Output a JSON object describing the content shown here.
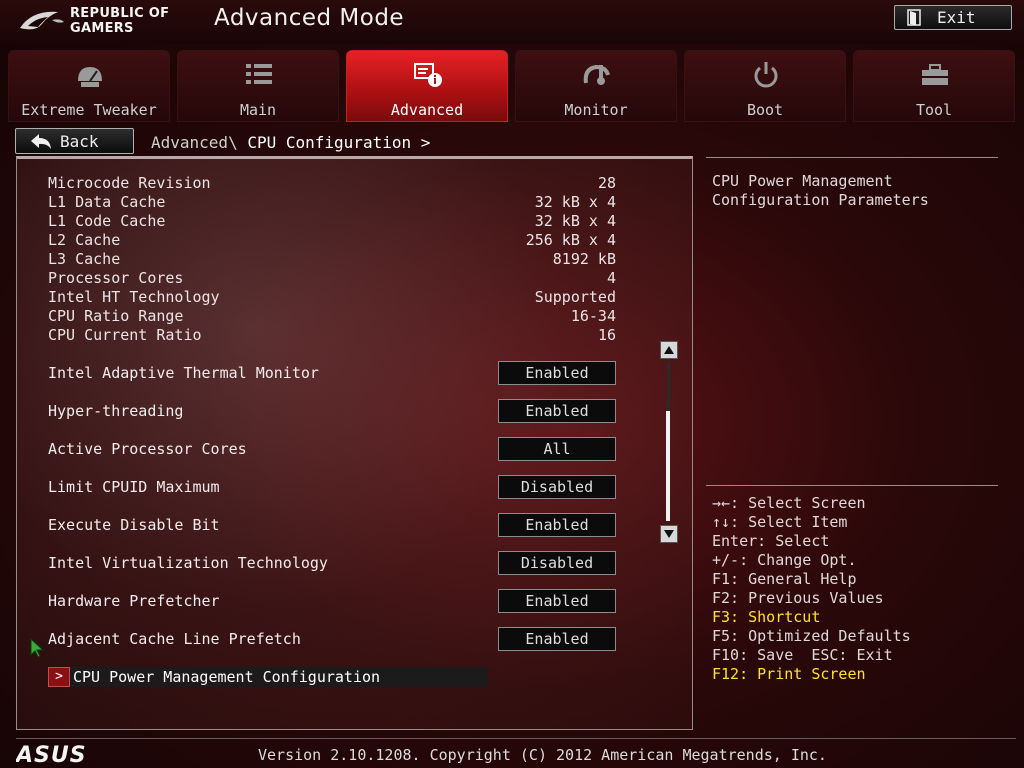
{
  "header": {
    "brand_line1": "REPUBLIC OF",
    "brand_line2": "GAMERS",
    "title": "Advanced Mode",
    "exit_label": "Exit"
  },
  "tabs": [
    {
      "label": "Extreme Tweaker",
      "icon": "extreme-tweaker-icon",
      "active": false
    },
    {
      "label": "Main",
      "icon": "list-icon",
      "active": false
    },
    {
      "label": "Advanced",
      "icon": "advanced-settings-icon",
      "active": true
    },
    {
      "label": "Monitor",
      "icon": "monitor-gauge-icon",
      "active": false
    },
    {
      "label": "Boot",
      "icon": "power-icon",
      "active": false
    },
    {
      "label": "Tool",
      "icon": "toolbox-icon",
      "active": false
    }
  ],
  "nav": {
    "back_label": "Back",
    "breadcrumb_parent": "Advanced\\",
    "breadcrumb_current": "CPU Configuration",
    "breadcrumb_sep": ">"
  },
  "info": [
    {
      "label": "Microcode Revision",
      "value": "28"
    },
    {
      "label": "L1 Data Cache",
      "value": "32 kB x 4"
    },
    {
      "label": "L1 Code Cache",
      "value": "32 kB x 4"
    },
    {
      "label": "L2 Cache",
      "value": "256 kB x 4"
    },
    {
      "label": "L3 Cache",
      "value": "8192 kB"
    },
    {
      "label": "Processor Cores",
      "value": "4"
    },
    {
      "label": "Intel HT Technology",
      "value": "Supported"
    },
    {
      "label": "CPU Ratio Range",
      "value": "16-34"
    },
    {
      "label": "CPU Current Ratio",
      "value": "16"
    }
  ],
  "settings": [
    {
      "label": "Intel Adaptive Thermal Monitor",
      "value": "Enabled"
    },
    {
      "label": "Hyper-threading",
      "value": "Enabled"
    },
    {
      "label": "Active Processor Cores",
      "value": "All"
    },
    {
      "label": "Limit CPUID Maximum",
      "value": "Disabled"
    },
    {
      "label": "Execute Disable Bit",
      "value": "Enabled"
    },
    {
      "label": "Intel Virtualization Technology",
      "value": "Disabled"
    },
    {
      "label": "Hardware Prefetcher",
      "value": "Enabled"
    },
    {
      "label": "Adjacent Cache Line Prefetch",
      "value": "Enabled"
    }
  ],
  "submenu": {
    "arrow": ">",
    "label": "CPU Power Management Configuration"
  },
  "help": {
    "text": "CPU Power Management Configuration Parameters"
  },
  "keys": [
    {
      "text": "→←: Select Screen",
      "highlight": false
    },
    {
      "text": "↑↓: Select Item",
      "highlight": false
    },
    {
      "text": "Enter: Select",
      "highlight": false
    },
    {
      "text": "+/-: Change Opt.",
      "highlight": false
    },
    {
      "text": "F1: General Help",
      "highlight": false
    },
    {
      "text": "F2: Previous Values",
      "highlight": false
    },
    {
      "text": "F3: Shortcut",
      "highlight": true
    },
    {
      "text": "F5: Optimized Defaults",
      "highlight": false
    },
    {
      "text": "F10: Save  ESC: Exit",
      "highlight": false
    },
    {
      "text": "F12: Print Screen",
      "highlight": true
    }
  ],
  "footer": {
    "brand": "ASUS",
    "version": "Version 2.10.1208. Copyright (C) 2012 American Megatrends, Inc."
  },
  "colors": {
    "accent_red": "#e62226",
    "highlight_yellow": "#ffe22a",
    "background_dark_red": "#2a0809"
  }
}
